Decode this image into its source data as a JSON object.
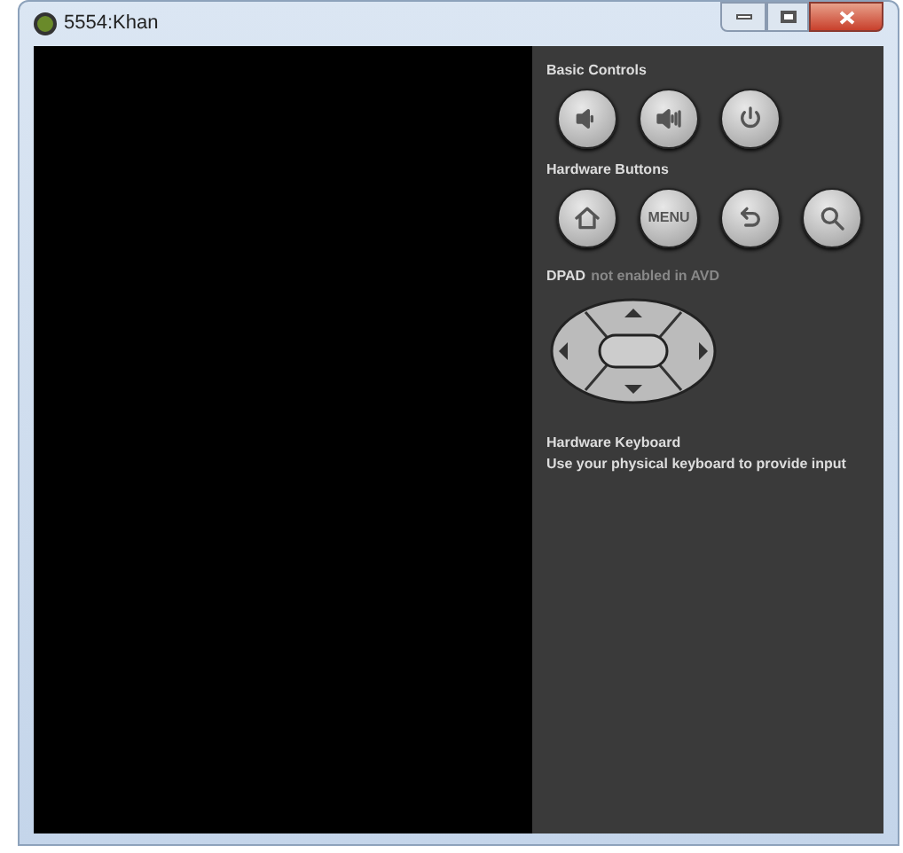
{
  "window": {
    "title": "5554:Khan"
  },
  "sections": [
    {
      "title": "Basic Controls",
      "buttons": [
        {
          "kind": "volume-down"
        },
        {
          "kind": "volume-up"
        },
        {
          "kind": "power"
        }
      ]
    },
    {
      "title": "Hardware Buttons",
      "buttons": [
        {
          "kind": "home"
        },
        {
          "kind": "text",
          "label": "MENU"
        },
        {
          "kind": "back"
        },
        {
          "kind": "search"
        }
      ]
    }
  ],
  "dpad": {
    "label": "DPAD",
    "note": "not enabled in AVD"
  },
  "keyboard": {
    "title": "Hardware Keyboard",
    "description": "Use your physical keyboard to provide input"
  }
}
